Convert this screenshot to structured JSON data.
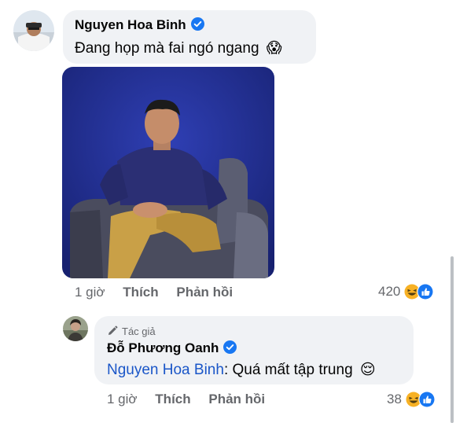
{
  "comment": {
    "author": "Nguyen Hoa Binh",
    "text": "Đang họp mà fai ngó ngang",
    "emoji": "😱",
    "time": "1 giờ",
    "like_label": "Thích",
    "reply_label": "Phản hồi",
    "reaction_count": "420"
  },
  "reply": {
    "badge": "Tác giả",
    "author": "Đỗ Phương Oanh",
    "mention": "Nguyen Hoa Binh",
    "text": ": Quá mất tập trung",
    "emoji": "😌",
    "time": "1 giờ",
    "like_label": "Thích",
    "reply_label": "Phản hồi",
    "reaction_count": "38"
  },
  "colors": {
    "bubble": "#f0f2f5",
    "mention": "#1a56c8",
    "meta": "#65676b",
    "verified": "#1877f2",
    "like_blue": "#1877f2",
    "haha_yellow": "#f7b125"
  },
  "icons": [
    "verified-badge-icon",
    "haha-reaction-icon",
    "like-reaction-icon",
    "pen-icon"
  ]
}
